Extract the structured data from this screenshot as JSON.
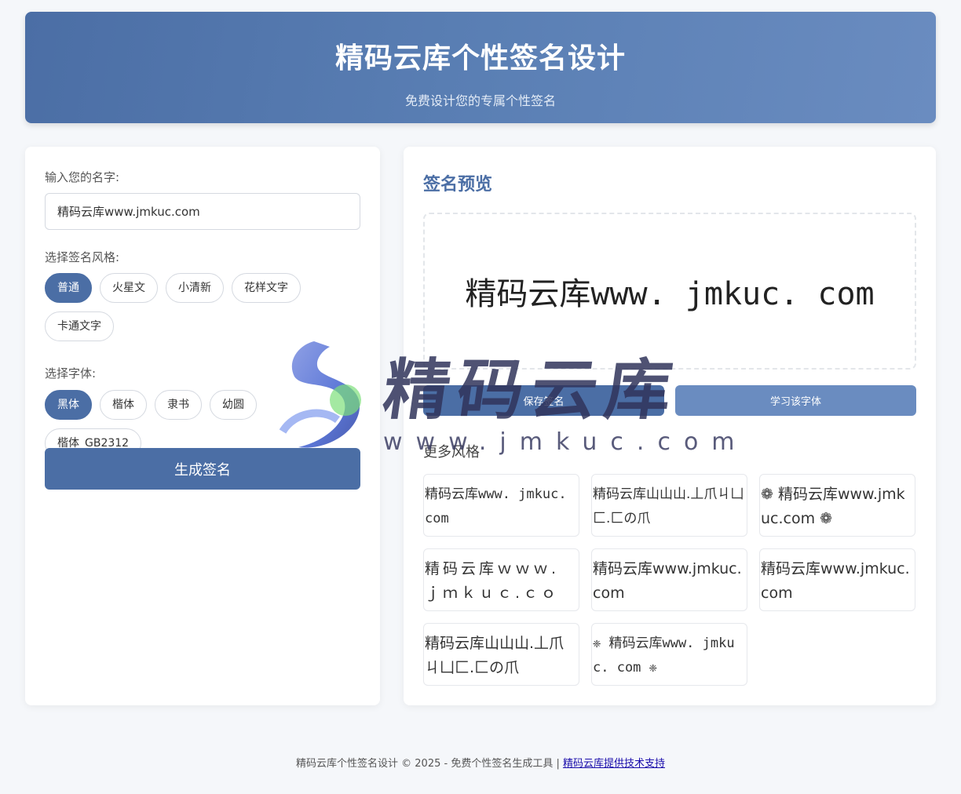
{
  "header": {
    "title": "精码云库个性签名设计",
    "subtitle": "免费设计您的专属个性签名"
  },
  "form": {
    "name_label": "输入您的名字:",
    "name_value": "精码云库www.jmkuc.com",
    "style_label": "选择签名风格:",
    "styles": [
      "普通",
      "火星文",
      "小清新",
      "花样文字",
      "卡通文字"
    ],
    "selected_style": "普通",
    "font_label": "选择字体:",
    "fonts": [
      "黑体",
      "楷体",
      "隶书",
      "幼圆",
      "楷体_GB2312"
    ],
    "selected_font": "黑体",
    "generate_label": "生成签名"
  },
  "preview": {
    "title": "签名预览",
    "text": "精码云库www. jmkuc. com",
    "save_label": "保存签名",
    "learn_label": "学习该字体",
    "more_title": "更多风格",
    "cards": [
      "精码云库www. jmkuc. com",
      "精码云库山山山.丄爪ㄐ凵匚.匚の爪",
      "❁ 精码云库www.jmkuc.com ❁",
      "精码云库ｗｗｗ.ｊｍｋｕｃ.ｃｏｍ",
      "精码云库www.jmkuc.com",
      "精码云库www.jmkuc.com",
      "精码云库山山山.丄爪ㄐ凵匚.匚の爪",
      "❈ 精码云库www. jmkuc. com ❈"
    ]
  },
  "watermark": {
    "text": "精码云库",
    "url": "www.jmkuc.com"
  },
  "footer": {
    "text": "精码云库个性签名设计 © 2025 - 免费个性签名生成工具 | ",
    "link": "精码云库提供技术支持"
  },
  "colors": {
    "primary": "#4b6ea5",
    "secondary": "#6a8cc0",
    "background": "#f5f7fa"
  }
}
